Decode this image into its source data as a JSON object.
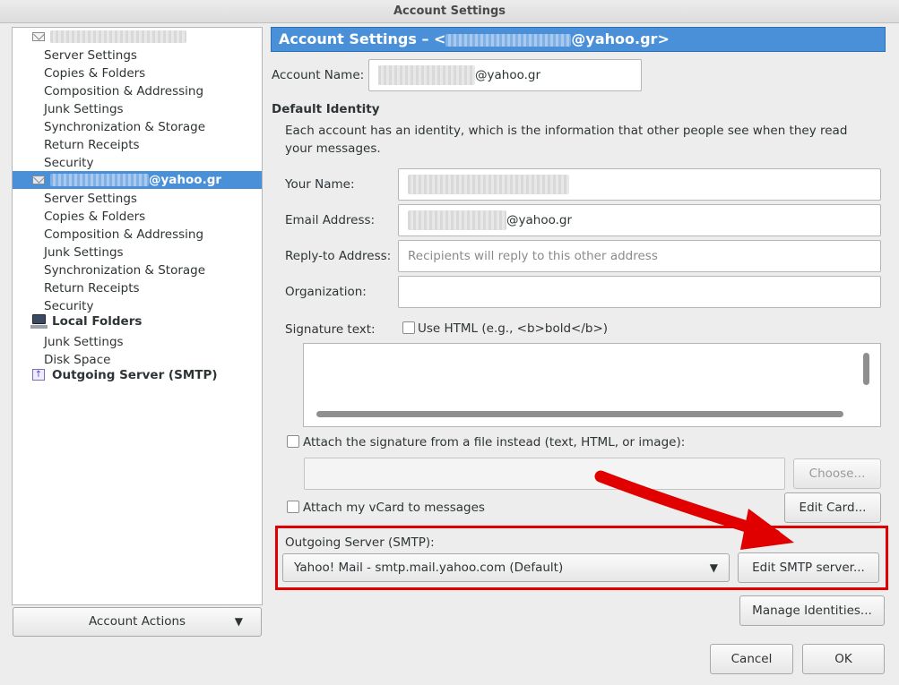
{
  "window": {
    "title": "Account Settings"
  },
  "tree": {
    "account1": {
      "children": [
        "Server Settings",
        "Copies & Folders",
        "Composition & Addressing",
        "Junk Settings",
        "Synchronization & Storage",
        "Return Receipts",
        "Security"
      ]
    },
    "account2": {
      "label_suffix": "@yahoo.gr",
      "children": [
        "Server Settings",
        "Copies & Folders",
        "Composition & Addressing",
        "Junk Settings",
        "Synchronization & Storage",
        "Return Receipts",
        "Security"
      ]
    },
    "local_folders": {
      "label": "Local Folders",
      "children": [
        "Junk Settings",
        "Disk Space"
      ]
    },
    "outgoing": {
      "label": "Outgoing Server (SMTP)"
    }
  },
  "account_actions": {
    "label": "Account Actions"
  },
  "header": {
    "prefix": "Account Settings – <",
    "suffix": "@yahoo.gr>"
  },
  "account_name": {
    "label": "Account Name:",
    "value_suffix": "@yahoo.gr"
  },
  "default_identity": {
    "heading": "Default Identity",
    "description": "Each account has an identity, which is the information that other people see when they read your messages."
  },
  "fields": {
    "your_name": {
      "label": "Your Name:"
    },
    "email": {
      "label": "Email Address:",
      "value_suffix": "@yahoo.gr"
    },
    "reply_to": {
      "label": "Reply-to Address:",
      "placeholder": "Recipients will reply to this other address"
    },
    "organization": {
      "label": "Organization:",
      "value": ""
    }
  },
  "signature": {
    "label": "Signature text:",
    "use_html_label": "Use HTML (e.g., <b>bold</b>)",
    "use_html_checked": false,
    "attach_file_label": "Attach the signature from a file instead (text, HTML, or image):",
    "attach_file_checked": false,
    "choose_label": "Choose..."
  },
  "vcard": {
    "label": "Attach my vCard to messages",
    "checked": false,
    "edit_card_label": "Edit Card..."
  },
  "smtp": {
    "label": "Outgoing Server (SMTP):",
    "selected": "Yahoo! Mail - smtp.mail.yahoo.com (Default)",
    "edit_label": "Edit SMTP server..."
  },
  "manage_identities_label": "Manage Identities...",
  "footer": {
    "cancel": "Cancel",
    "ok": "OK"
  },
  "colors": {
    "selection": "#4a90d9",
    "highlight_box": "#e00000",
    "arrow": "#e00000"
  }
}
